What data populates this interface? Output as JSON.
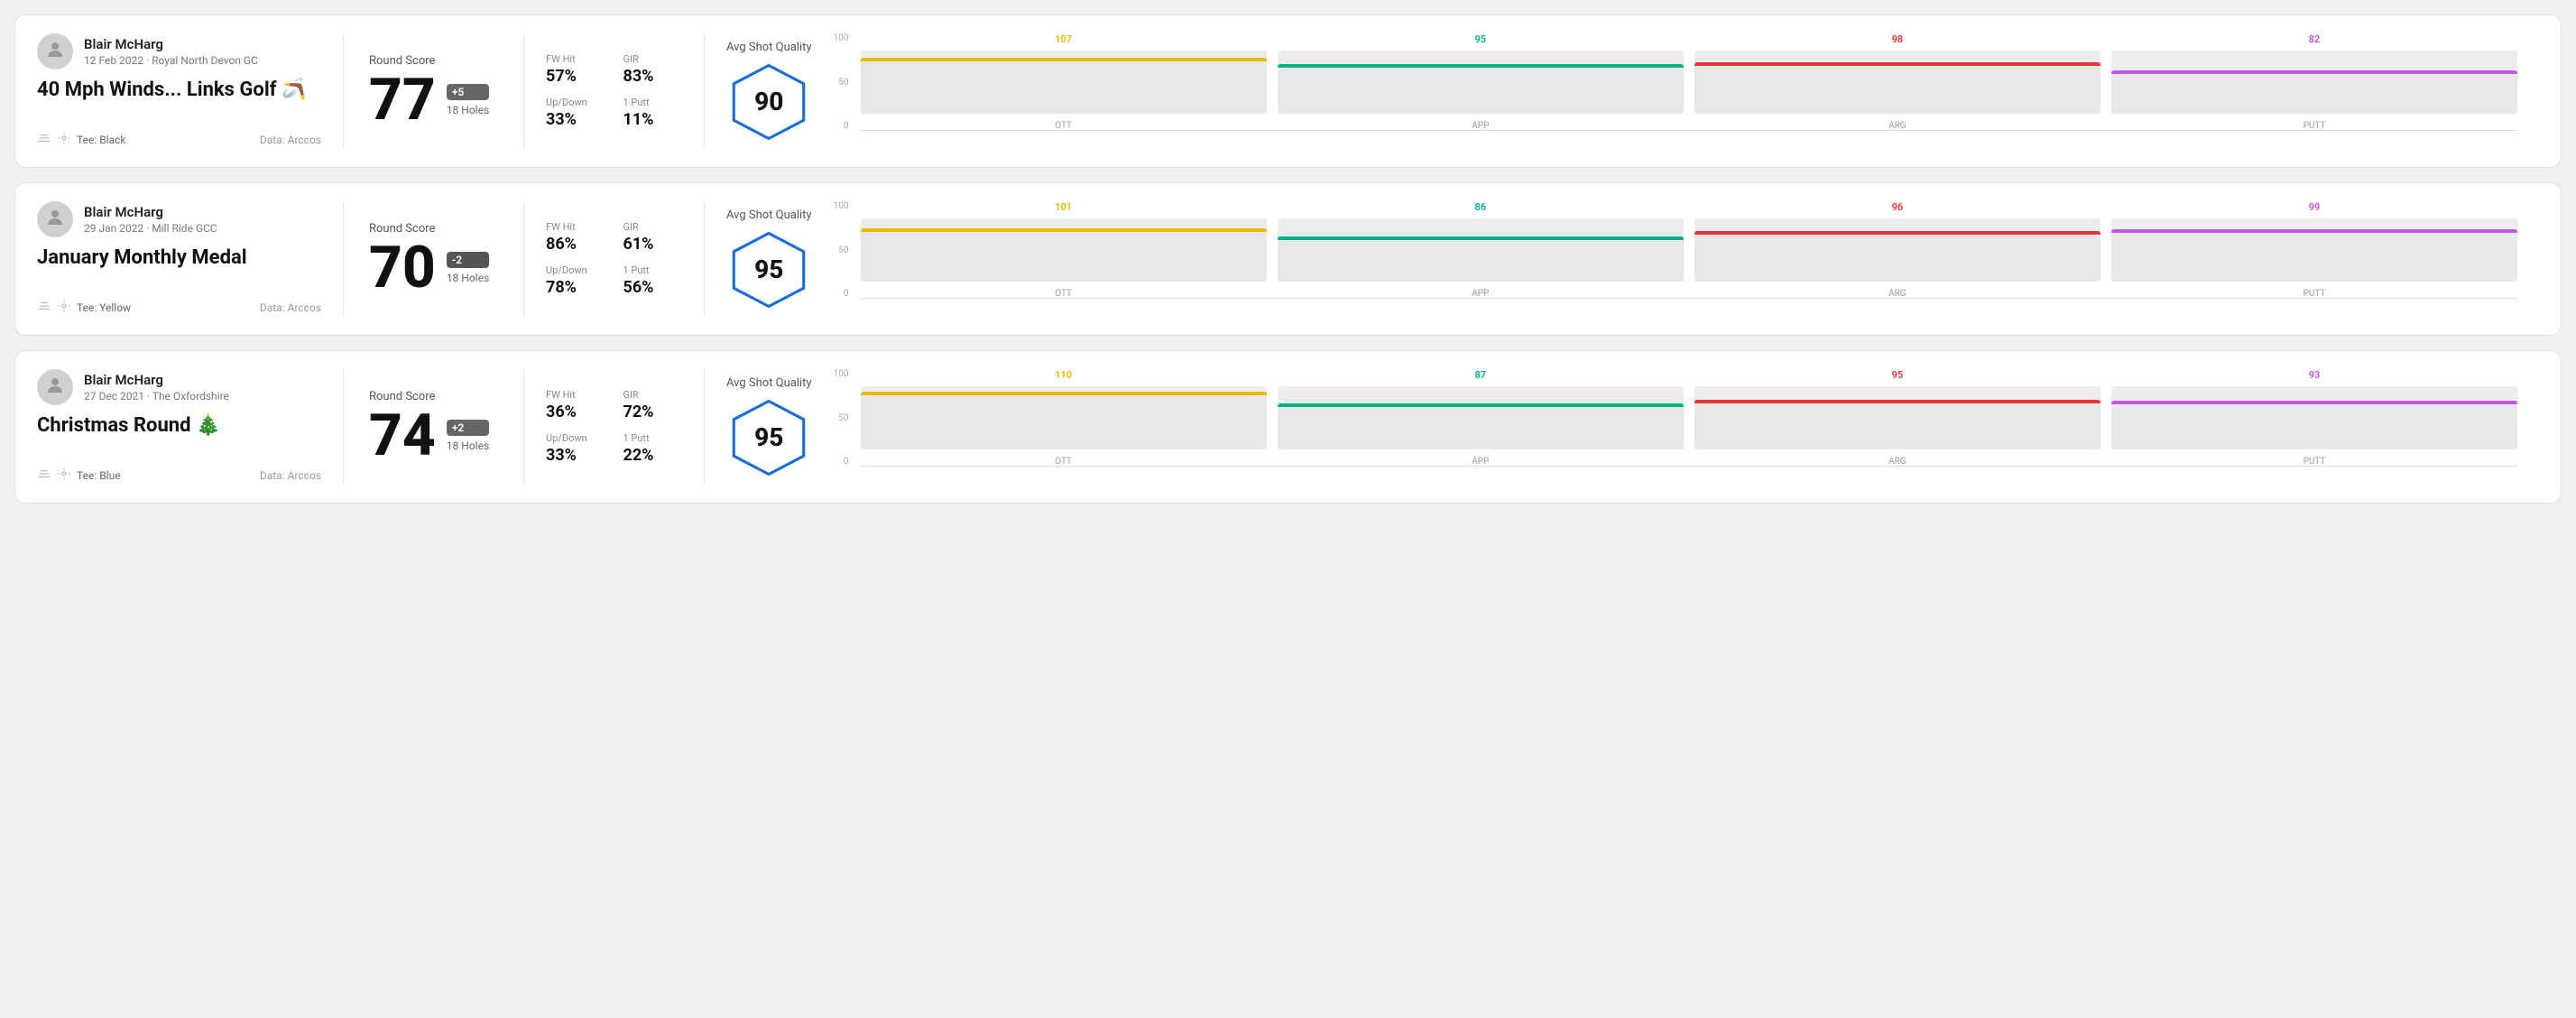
{
  "rounds": [
    {
      "id": "round-1",
      "user": {
        "name": "Blair McHarg",
        "date": "12 Feb 2022",
        "course": "Royal North Devon GC"
      },
      "title": "40 Mph Winds... Links Golf",
      "title_emoji": "🪃",
      "tee": "Black",
      "data_source": "Data: Arccos",
      "score": "77",
      "score_diff": "+5",
      "holes": "18 Holes",
      "fw_hit": "57%",
      "gir": "83%",
      "up_down": "33%",
      "one_putt": "11%",
      "avg_quality": "90",
      "chart": {
        "ott": {
          "value": 107,
          "color": "#e6b800"
        },
        "app": {
          "value": 95,
          "color": "#00b386"
        },
        "arg": {
          "value": 98,
          "color": "#e63333"
        },
        "putt": {
          "value": 82,
          "color": "#c455e0"
        }
      }
    },
    {
      "id": "round-2",
      "user": {
        "name": "Blair McHarg",
        "date": "29 Jan 2022",
        "course": "Mill Ride GCC"
      },
      "title": "January Monthly Medal",
      "title_emoji": "",
      "tee": "Yellow",
      "data_source": "Data: Arccos",
      "score": "70",
      "score_diff": "-2",
      "holes": "18 Holes",
      "fw_hit": "86%",
      "gir": "61%",
      "up_down": "78%",
      "one_putt": "56%",
      "avg_quality": "95",
      "chart": {
        "ott": {
          "value": 101,
          "color": "#e6b800"
        },
        "app": {
          "value": 86,
          "color": "#00b386"
        },
        "arg": {
          "value": 96,
          "color": "#e63333"
        },
        "putt": {
          "value": 99,
          "color": "#c455e0"
        }
      }
    },
    {
      "id": "round-3",
      "user": {
        "name": "Blair McHarg",
        "date": "27 Dec 2021",
        "course": "The Oxfordshire"
      },
      "title": "Christmas Round",
      "title_emoji": "🎄",
      "tee": "Blue",
      "data_source": "Data: Arccos",
      "score": "74",
      "score_diff": "+2",
      "holes": "18 Holes",
      "fw_hit": "36%",
      "gir": "72%",
      "up_down": "33%",
      "one_putt": "22%",
      "avg_quality": "95",
      "chart": {
        "ott": {
          "value": 110,
          "color": "#e6b800"
        },
        "app": {
          "value": 87,
          "color": "#00b386"
        },
        "arg": {
          "value": 95,
          "color": "#e63333"
        },
        "putt": {
          "value": 93,
          "color": "#c455e0"
        }
      }
    }
  ],
  "labels": {
    "round_score": "Round Score",
    "fw_hit": "FW Hit",
    "gir": "GIR",
    "up_down": "Up/Down",
    "one_putt": "1 Putt",
    "avg_quality": "Avg Shot Quality",
    "data_label": "Data: Arccos",
    "chart_labels": [
      "OTT",
      "APP",
      "ARG",
      "PUTT"
    ],
    "chart_y": [
      "100",
      "50",
      "0"
    ]
  }
}
